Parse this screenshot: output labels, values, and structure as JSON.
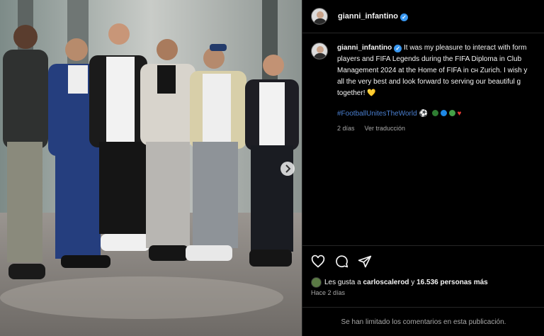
{
  "post": {
    "username": "gianni_infantino",
    "verified_glyph": "✓",
    "caption_lines": [
      "It was my pleasure to interact with form",
      "players and FIFA Legends during the FIFA Diploma in Club",
      "Management 2024 at the Home of FIFA in ᴄʜ Zurich. I wish y",
      "all the very best and look forward to serving our beautiful g",
      "together! 💛"
    ],
    "hashtag": "#FootballUnitesTheWorld",
    "hashtag_emoji_after": "⚽",
    "hashtag_heart": "♥",
    "globe_colors": [
      "#2e7d32",
      "#1e88e5",
      "#43a047"
    ],
    "heart_color": "#e53935",
    "time_ago": "2 días",
    "translate": "Ver traducción",
    "likes_prefix": "Les gusta a ",
    "likes_user": "carloscalerod",
    "likes_mid": " y ",
    "likes_count": "16.536 personas más",
    "posted_ago": "Hace 2 días",
    "comments_limited": "Se han limitado los comentarios en esta publicación."
  },
  "icons": [
    "heart-icon",
    "comment-icon",
    "share-icon",
    "next-arrow-icon",
    "verified-icon"
  ]
}
